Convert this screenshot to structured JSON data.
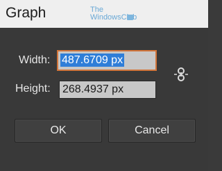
{
  "window": {
    "title": "Graph",
    "watermark_line1": "The",
    "watermark_line2": "WindowsClub"
  },
  "fields": {
    "width_label": "Width:",
    "width_value": "487.6709 px",
    "height_label": "Height:",
    "height_value": "268.4937 px"
  },
  "link_icon": "constrain-proportions-link-icon",
  "buttons": {
    "ok": "OK",
    "cancel": "Cancel"
  },
  "colors": {
    "dialog_bg": "#393939",
    "focus_border": "#d2753a",
    "selection": "#2f7ed8"
  }
}
